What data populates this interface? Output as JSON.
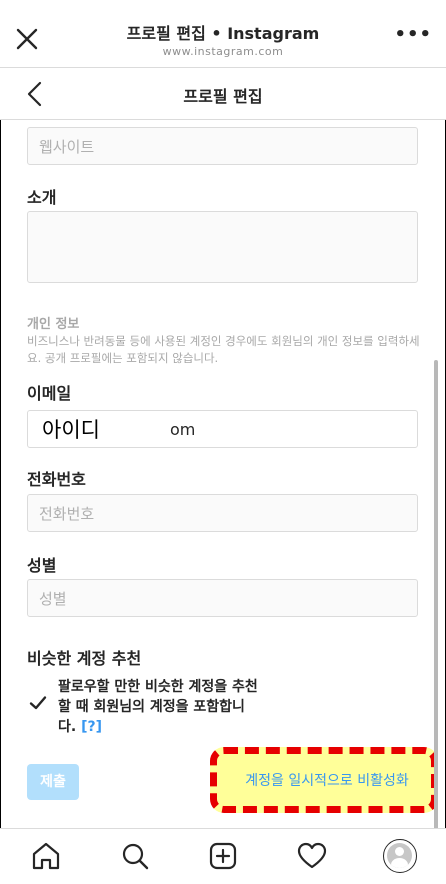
{
  "browser": {
    "title": "프로필 편집 • Instagram",
    "url": "www.instagram.com",
    "more": "•••"
  },
  "header": {
    "title": "프로필 편집"
  },
  "form": {
    "website_placeholder": "웹사이트",
    "bio_label": "소개",
    "private_title": "개인 정보",
    "private_desc": "비즈니스나 반려동물 등에 사용된 계정인 경우에도 회원님의 개인 정보를 입력하세요. 공개 프로필에는 포함되지 않습니다.",
    "email_label": "이메일",
    "email_overlay": "아이디",
    "email_suffix": "om",
    "phone_label": "전화번호",
    "phone_placeholder": "전화번호",
    "gender_label": "성별",
    "gender_placeholder": "성별",
    "suggest_label": "비슷한 계정 추천",
    "suggest_text": "팔로우할 만한 비슷한 계정을 추천할 때 회원님의 계정을 포함합니다.",
    "help": "[?]",
    "submit": "제출",
    "deactivate": "계정을 일시적으로 비활성화"
  },
  "colors": {
    "link": "#3897f0",
    "highlight": "#ffff99",
    "highlight_border": "#e60000"
  },
  "icons": [
    "close-icon",
    "more-icon",
    "back-icon",
    "check-icon",
    "home-icon",
    "search-icon",
    "new-post-icon",
    "heart-icon",
    "avatar"
  ]
}
